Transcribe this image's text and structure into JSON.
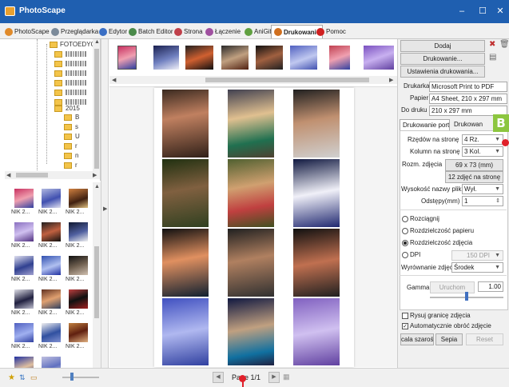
{
  "window": {
    "title": "PhotoScape",
    "controls": [
      "–",
      "☐",
      "✕"
    ]
  },
  "tabs": [
    {
      "label": "PhotoScape",
      "icon": "photoscape-icon",
      "color": "#e08a2a"
    },
    {
      "label": "Przeglądarka",
      "icon": "viewer-icon",
      "color": "#7b8a9a"
    },
    {
      "label": "Edytor",
      "icon": "editor-icon",
      "color": "#3a6fc4"
    },
    {
      "label": "Batch Editor",
      "icon": "batch-icon",
      "color": "#4a8a4a"
    },
    {
      "label": "Strona",
      "icon": "page-icon",
      "color": "#c0404a"
    },
    {
      "label": "Łączenie",
      "icon": "combine-icon",
      "color": "#a050a0"
    },
    {
      "label": "AniGif",
      "icon": "anigif-icon",
      "color": "#60a040"
    },
    {
      "label": "Drukowanie",
      "icon": "print-icon",
      "color": "#d07020",
      "active": true
    },
    {
      "label": "Pomoc",
      "icon": "help-icon",
      "color": "#d02020"
    }
  ],
  "tree": {
    "root_label": "FOTOEDYC",
    "year_label": "2015",
    "sub_labels": [
      "B",
      "s",
      "U",
      "r",
      "n",
      "r",
      "g",
      "v"
    ]
  },
  "thumbnails": {
    "label": "NIK 2..."
  },
  "print_panel": {
    "add_button": "Dodaj",
    "print_button": "Drukowanie...",
    "settings_button": "Ustawienia drukowania...",
    "printer_label": "Drukarka",
    "printer_value": "Microsoft Print to PDF",
    "paper_label": "Papier",
    "paper_value": "A4 Sheet, 210 x 297 mm",
    "print_area_label": "Do druku",
    "print_area_value": "210 x 297 mm",
    "tab_portrait": "Drukowanie portretu",
    "tab_other": "Drukowan",
    "rows_label": "Rzędów na stronę",
    "rows_value": "4 Rz.",
    "cols_label": "Kolumn na stronę",
    "cols_value": "3 Kol.",
    "size_label": "Rozm. zdjęcia",
    "size_value": "69 x 73 (mm)",
    "per_page_value": "12 zdjęć na stronę",
    "filename_height_label": "Wysokość nazwy pliku",
    "filename_height_value": "Wył.",
    "spacing_label": "Odstępy(mm)",
    "spacing_value": "1",
    "radio_stretch": "Rozciągnij",
    "radio_paper_res": "Rozdzielczość papieru",
    "radio_photo_res": "Rozdzielczość zdjęcia",
    "radio_dpi": "DPI",
    "dpi_value": "150 DPI",
    "align_label": "Wyrównanie zdjęć",
    "align_value": "Środek",
    "gamma_label": "Gamma",
    "gamma_button": "Uruchom",
    "gamma_value": "1.00",
    "gamma_level": 0.5,
    "check_border": "Rysuj granicę zdjęcia",
    "check_border_checked": false,
    "check_rotate": "Automatycznie obróć zdjęcie",
    "check_rotate_checked": true,
    "btn_gray": "cala szarość",
    "btn_sepia": "Sepia",
    "btn_reset": "Reset"
  },
  "footer": {
    "page_label": "Page 1/1"
  },
  "annotation": {
    "badge": "B",
    "badge_color": "#8cc63f",
    "pin_color": "#e0202a"
  }
}
